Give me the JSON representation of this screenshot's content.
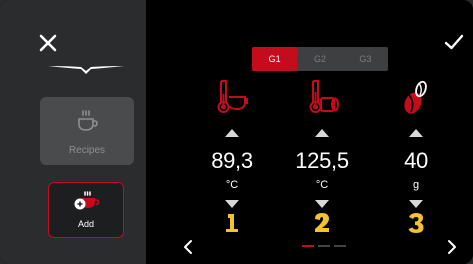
{
  "colors": {
    "accent": "#c40c1c",
    "number_yellow": "#f2c230"
  },
  "sidebar": {
    "close_icon": "close-icon",
    "recipes": {
      "label": "Recipes",
      "icon": "coffee-cup-icon",
      "state": "disabled"
    },
    "add": {
      "label": "Add",
      "icon": "add-cup-icon"
    }
  },
  "header": {
    "confirm_icon": "check-icon"
  },
  "tabs": [
    {
      "label": "G1",
      "active": true
    },
    {
      "label": "G2",
      "active": false
    },
    {
      "label": "G3",
      "active": false
    }
  ],
  "settings": [
    {
      "icon": "boiler-temperature-icon",
      "value": "89,3",
      "unit": "°C",
      "number": "1"
    },
    {
      "icon": "steam-temperature-icon",
      "value": "125,5",
      "unit": "°C",
      "number": "2"
    },
    {
      "icon": "coffee-bean-dose-icon",
      "value": "40",
      "unit": "g",
      "number": "3"
    }
  ],
  "pagination": {
    "pages": 3,
    "current": 1
  },
  "nav": {
    "prev_icon": "chevron-left-icon",
    "next_icon": "chevron-right-icon"
  }
}
